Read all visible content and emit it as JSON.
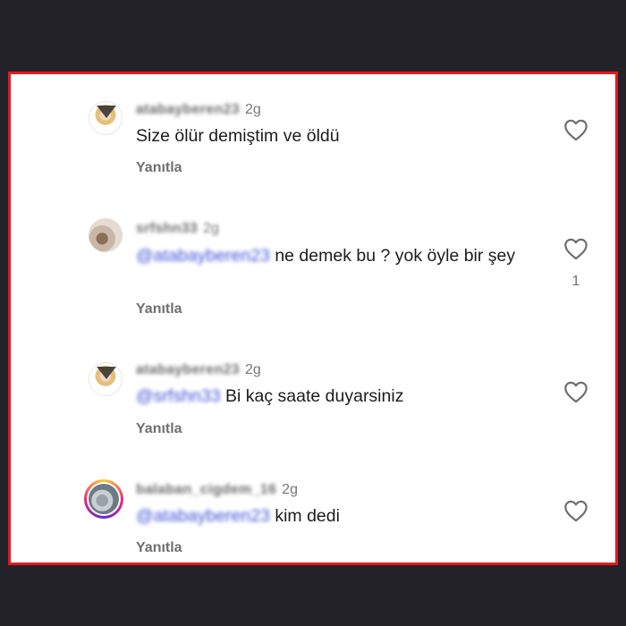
{
  "comments": [
    {
      "username": "atabayberen23",
      "time": "2g",
      "mention": "",
      "text": "Size ölür demiştim ve öldü",
      "reply_label": "Yanıtla",
      "like_count": ""
    },
    {
      "username": "srfshn33",
      "time": "2g",
      "mention": "@atabayberen23",
      "text": "ne demek bu ? yok öyle bir şey",
      "reply_label": "Yanıtla",
      "like_count": "1"
    },
    {
      "username": "atabayberen23",
      "time": "2g",
      "mention": "@srfshn33",
      "text": "Bi kaç saate duyarsiniz",
      "reply_label": "Yanıtla",
      "like_count": ""
    },
    {
      "username": "balaban_cigdem_16",
      "time": "2g",
      "mention": "@atabayberen23",
      "text": "kim dedi",
      "reply_label": "Yanıtla",
      "like_count": ""
    }
  ],
  "colors": {
    "frame_border": "#e3191f",
    "mention": "#3f56d6",
    "background": "#232228"
  },
  "icons": {
    "like": "heart-outline-icon"
  }
}
